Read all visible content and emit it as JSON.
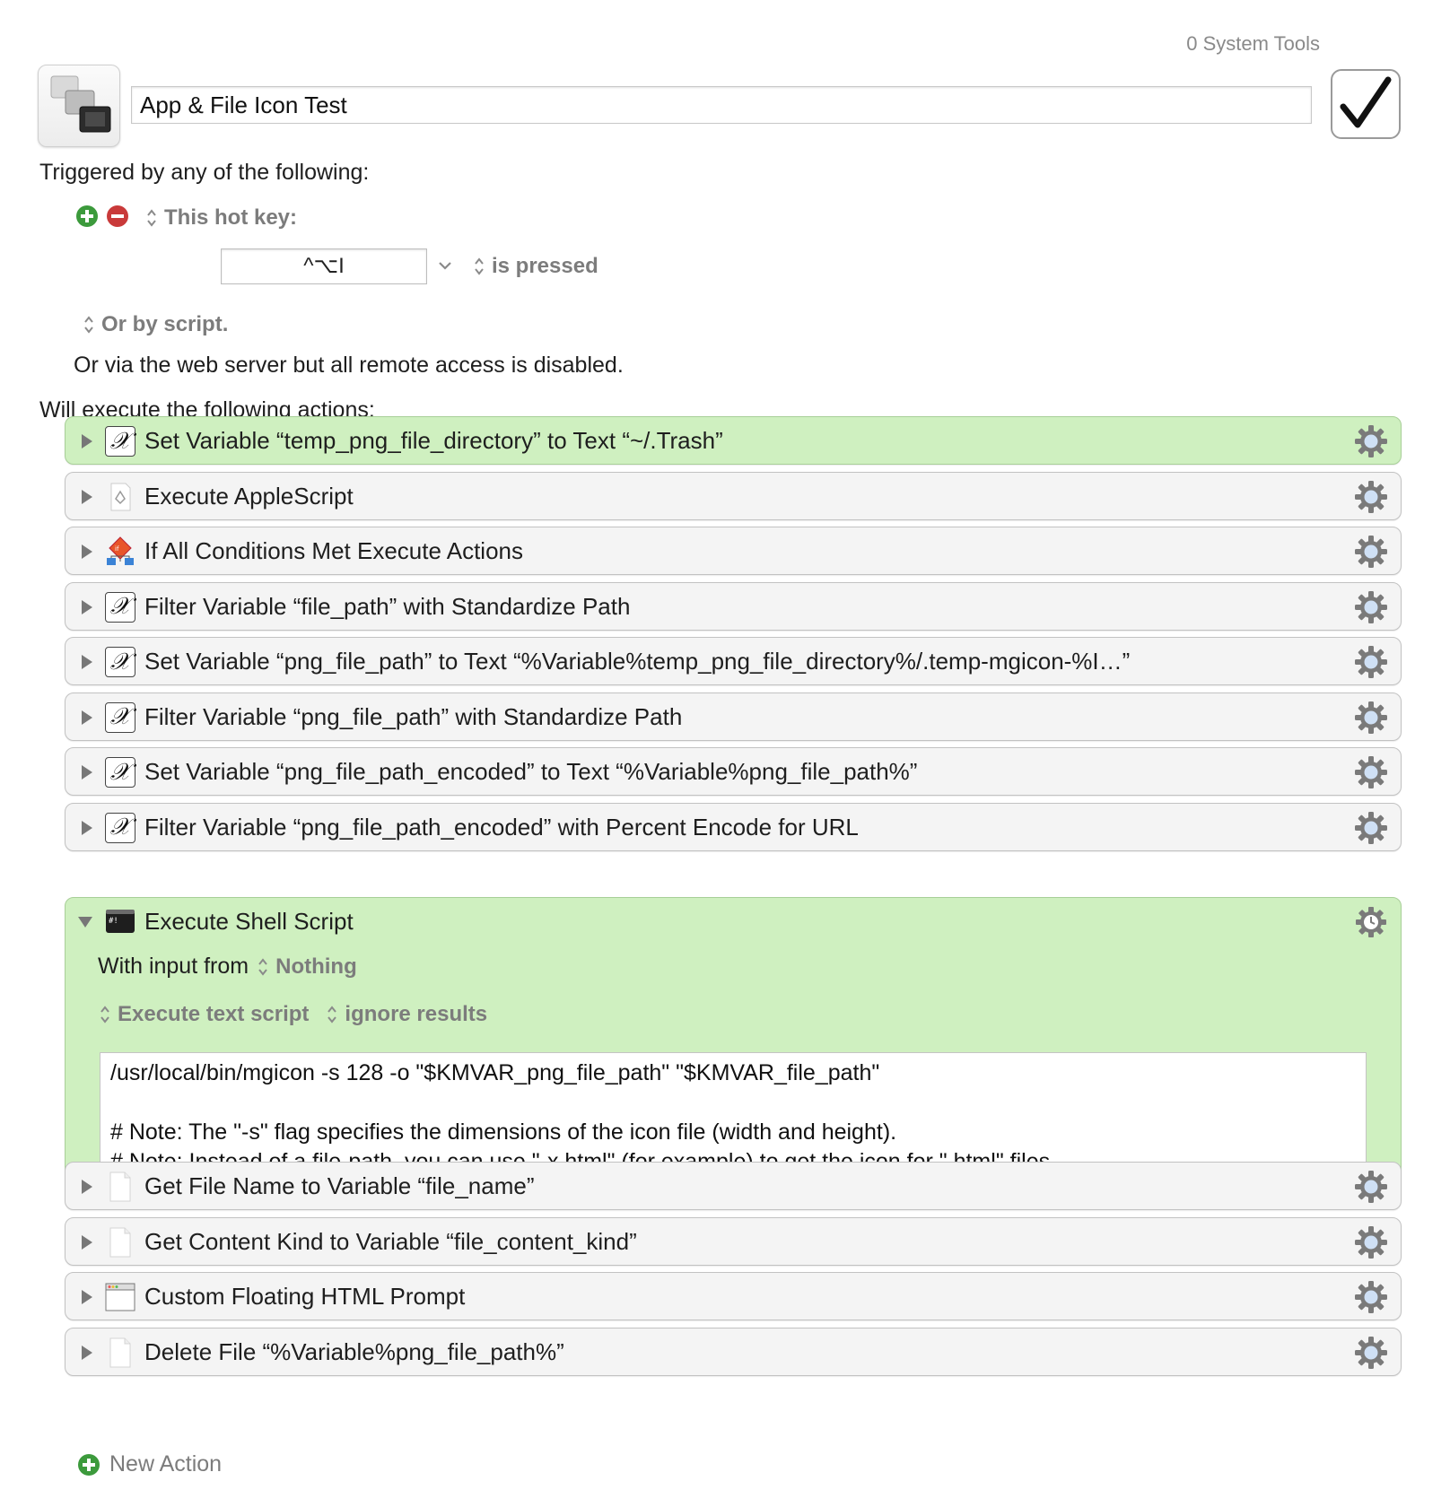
{
  "header": {
    "group_name": "0 System Tools",
    "macro_name": "App & File Icon Test",
    "enabled": true
  },
  "triggers": {
    "heading": "Triggered by any of the following:",
    "hotkey_trigger_type": "This hot key:",
    "hotkey_value": "^⌥I",
    "hotkey_condition": "is pressed",
    "script_trigger": "Or by script.",
    "web_server_note": "Or via the web server but all remote access is disabled."
  },
  "actions_heading": "Will execute the following actions:",
  "actions": [
    {
      "title": "Set Variable “temp_png_file_directory” to Text “~/.Trash”",
      "icon": "variable-icon",
      "highlighted": true
    },
    {
      "title": "Execute AppleScript",
      "icon": "applescript-icon",
      "highlighted": false
    },
    {
      "title": "If All Conditions Met Execute Actions",
      "icon": "if-then-icon",
      "highlighted": false
    },
    {
      "title": "Filter Variable “file_path” with Standardize Path",
      "icon": "variable-icon",
      "highlighted": false
    },
    {
      "title": "Set Variable “png_file_path” to Text “%Variable%temp_png_file_directory%/.temp-mgicon-%I…”",
      "icon": "variable-icon",
      "highlighted": false
    },
    {
      "title": "Filter Variable “png_file_path” with Standardize Path",
      "icon": "variable-icon",
      "highlighted": false
    },
    {
      "title": "Set Variable “png_file_path_encoded” to Text “%Variable%png_file_path%”",
      "icon": "variable-icon",
      "highlighted": false
    },
    {
      "title": "Filter Variable “png_file_path_encoded” with Percent Encode for URL",
      "icon": "variable-icon",
      "highlighted": false
    }
  ],
  "shell_action": {
    "title": "Execute Shell Script",
    "input_label": "With input from",
    "input_value": "Nothing",
    "mode": "Execute text script",
    "results": "ignore results",
    "script": "/usr/local/bin/mgicon -s 128 -o \"$KMVAR_png_file_path\" \"$KMVAR_file_path\"\n\n# Note: The \"-s\" flag specifies the dimensions of the icon file (width and height).\n# Note: Instead of a file-path, you can use \"-x html\" (for example) to get the icon for \".html\" files."
  },
  "actions_after": [
    {
      "title": "Get File Name to Variable “file_name”",
      "icon": "file-icon"
    },
    {
      "title": "Get Content Kind to Variable “file_content_kind”",
      "icon": "file-icon"
    },
    {
      "title": "Custom Floating HTML Prompt",
      "icon": "html-window-icon"
    },
    {
      "title": "Delete File “%Variable%png_file_path%”",
      "icon": "file-icon"
    }
  ],
  "new_action_label": "New Action",
  "colors": {
    "highlight_green": "#cff0c0",
    "add_green": "#3c9a3c",
    "remove_red": "#c93a3a",
    "gear_blue": "#8fb6e8"
  }
}
